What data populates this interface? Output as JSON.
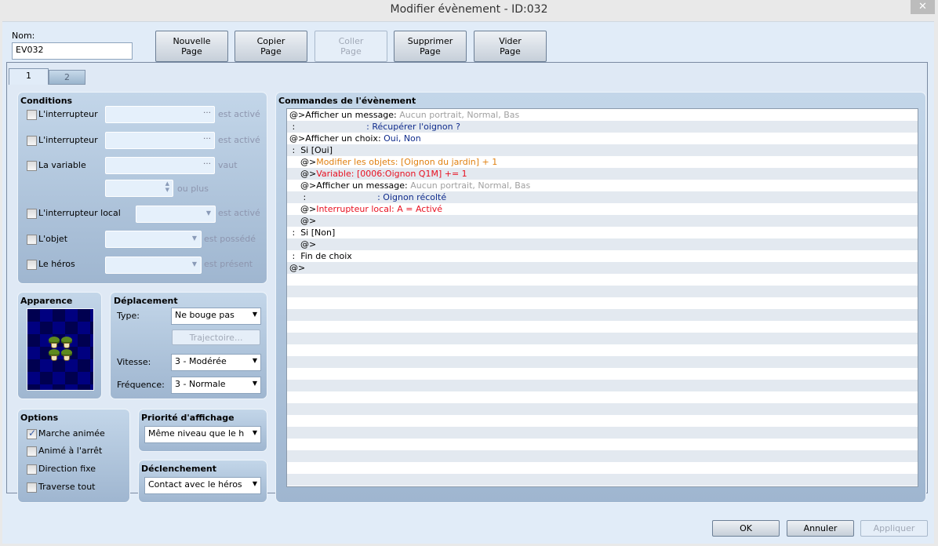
{
  "window": {
    "title": "Modifier évènement - ID:032",
    "close_icon": "close-x-icon"
  },
  "name_field": {
    "label": "Nom:",
    "value": "EV032"
  },
  "toolbar": {
    "new_page": [
      "Nouvelle",
      "Page"
    ],
    "copy_page": [
      "Copier",
      "Page"
    ],
    "paste_page": [
      "Coller",
      "Page"
    ],
    "delete_page": [
      "Supprimer",
      "Page"
    ],
    "clear_page": [
      "Vider",
      "Page"
    ]
  },
  "tabs": [
    {
      "label": "1",
      "active": true
    },
    {
      "label": "2",
      "active": false
    }
  ],
  "conditions": {
    "title": "Conditions",
    "switch1": {
      "label": "L'interrupteur",
      "checked": false,
      "value": "",
      "hint": "est activé"
    },
    "switch2": {
      "label": "L'interrupteur",
      "checked": false,
      "value": "",
      "hint": "est activé"
    },
    "variable": {
      "label": "La variable",
      "checked": false,
      "value": "",
      "hint": "vaut",
      "amount": "",
      "amount_hint": "ou plus"
    },
    "self_switch": {
      "label": "L'interrupteur local",
      "checked": false,
      "value": "",
      "hint": "est activé"
    },
    "item": {
      "label": "L'objet",
      "checked": false,
      "value": "",
      "hint": "est possédé"
    },
    "actor": {
      "label": "Le héros",
      "checked": false,
      "value": "",
      "hint": "est présent"
    }
  },
  "appearance": {
    "title": "Apparence",
    "sprite": "potted-plants-sprite"
  },
  "movement": {
    "title": "Déplacement",
    "type_label": "Type:",
    "type_value": "Ne bouge pas",
    "route_button": "Trajectoire...",
    "speed_label": "Vitesse:",
    "speed_value": "3 - Modérée",
    "freq_label": "Fréquence:",
    "freq_value": "3 - Normale"
  },
  "options": {
    "title": "Options",
    "items": [
      {
        "label": "Marche animée",
        "checked": true
      },
      {
        "label": "Animé à l'arrêt",
        "checked": false
      },
      {
        "label": "Direction fixe",
        "checked": false
      },
      {
        "label": "Traverse tout",
        "checked": false
      }
    ]
  },
  "priority": {
    "title": "Priorité d'affichage",
    "value": "Même niveau que le h"
  },
  "trigger": {
    "title": "Déclenchement",
    "value": "Contact avec le héros"
  },
  "commands": {
    "title": "Commandes de l'évènement",
    "rows": [
      [
        {
          "t": "@>Afficher un message: ",
          "c": ""
        },
        {
          "t": "Aucun portrait, Normal, Bas",
          "c": "gray"
        }
      ],
      [
        {
          "t": " :                          ",
          "c": ""
        },
        {
          "t": ": Récupérer l'oignon ?",
          "c": "blue"
        }
      ],
      [
        {
          "t": "@>Afficher un choix: ",
          "c": ""
        },
        {
          "t": "Oui, Non",
          "c": "blue"
        }
      ],
      [
        {
          "t": " :  Si [Oui]",
          "c": ""
        }
      ],
      [
        {
          "t": "    @>",
          "c": ""
        },
        {
          "t": "Modifier les objets: [Oignon du jardin] + 1",
          "c": "orange"
        }
      ],
      [
        {
          "t": "    @>",
          "c": ""
        },
        {
          "t": "Variable: [0006:Oignon Q1M] += 1",
          "c": "red"
        }
      ],
      [
        {
          "t": "    @>Afficher un message: ",
          "c": ""
        },
        {
          "t": "Aucun portrait, Normal, Bas",
          "c": "gray"
        }
      ],
      [
        {
          "t": "     :                          ",
          "c": ""
        },
        {
          "t": ": Oignon récolté",
          "c": "blue"
        }
      ],
      [
        {
          "t": "    @>",
          "c": ""
        },
        {
          "t": "Interrupteur local: A = Activé",
          "c": "red"
        }
      ],
      [
        {
          "t": "    @>",
          "c": ""
        }
      ],
      [
        {
          "t": " :  Si [Non]",
          "c": ""
        }
      ],
      [
        {
          "t": "    @>",
          "c": ""
        }
      ],
      [
        {
          "t": " :  Fin de choix",
          "c": ""
        }
      ],
      [
        {
          "t": "@>",
          "c": ""
        }
      ]
    ]
  },
  "footer": {
    "ok": "OK",
    "cancel": "Annuler",
    "apply": "Appliquer"
  }
}
